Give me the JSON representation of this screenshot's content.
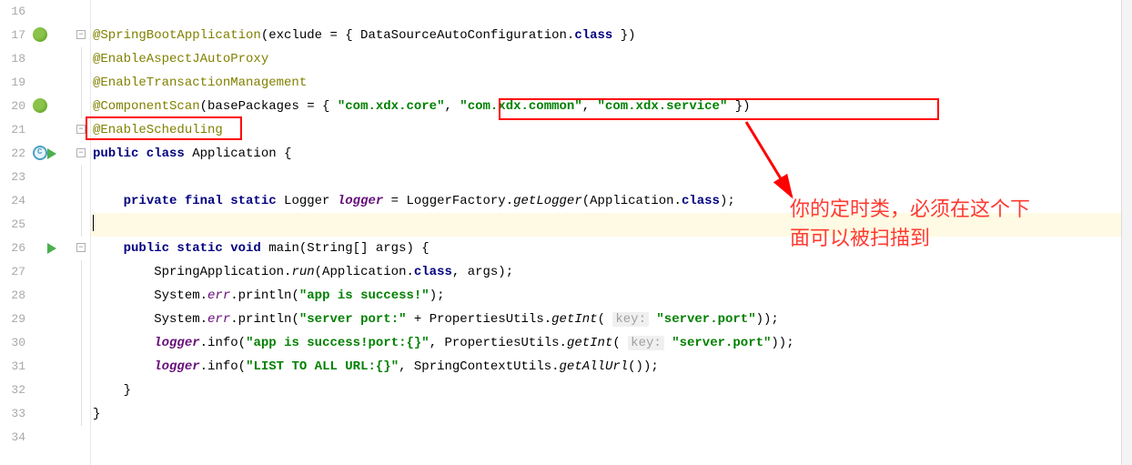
{
  "gutter": {
    "start": 16,
    "end": 34
  },
  "code": {
    "l16": "",
    "l17_ann": "@SpringBootApplication",
    "l17_rest": "(exclude = { DataSourceAutoConfiguration.",
    "l17_kw": "class",
    "l17_end": " })",
    "l18": "@EnableAspectJAutoProxy",
    "l19": "@EnableTransactionManagement",
    "l20_ann": "@ComponentScan",
    "l20_mid": "(basePackages = { ",
    "l20_s1": "\"com.xdx.core\"",
    "l20_c1": ", ",
    "l20_s2": "\"com.xdx.common\"",
    "l20_c2": ", ",
    "l20_s3": "\"com.xdx.service\"",
    "l20_end": " })",
    "l21": "@EnableScheduling",
    "l22_a": "public class ",
    "l22_b": "Application {",
    "l23": "",
    "l24_a": "    ",
    "l24_kw": "private final static ",
    "l24_type": "Logger ",
    "l24_var": "logger",
    "l24_eq": " = LoggerFactory.",
    "l24_call": "getLogger",
    "l24_arg": "(Application.",
    "l24_kw2": "class",
    "l24_end": ");",
    "l25": "    ",
    "l26_a": "    ",
    "l26_kw": "public static void ",
    "l26_rest": "main(String[] args) {",
    "l27_a": "        SpringApplication.",
    "l27_call": "run",
    "l27_b": "(Application.",
    "l27_kw": "class",
    "l27_c": ", args);",
    "l28_a": "        System.",
    "l28_err": "err",
    "l28_b": ".println(",
    "l28_s": "\"app is success!\"",
    "l28_c": ");",
    "l29_a": "        System.",
    "l29_err": "err",
    "l29_b": ".println(",
    "l29_s": "\"server port:\"",
    "l29_c": " + PropertiesUtils.",
    "l29_call": "getInt",
    "l29_d": "( ",
    "l29_hint": "key:",
    "l29_e": " ",
    "l29_s2": "\"server.port\"",
    "l29_f": "));",
    "l30_a": "        ",
    "l30_log": "logger",
    "l30_b": ".info(",
    "l30_s": "\"app is success!port:{}\"",
    "l30_c": ", PropertiesUtils.",
    "l30_call": "getInt",
    "l30_d": "( ",
    "l30_hint": "key:",
    "l30_e": " ",
    "l30_s2": "\"server.port\"",
    "l30_f": "));",
    "l31_a": "        ",
    "l31_log": "logger",
    "l31_b": ".info(",
    "l31_s": "\"LIST TO ALL URL:{}\"",
    "l31_c": ", SpringContextUtils.",
    "l31_call": "getAllUrl",
    "l31_d": "());",
    "l32": "    }",
    "l33": "}",
    "l34": ""
  },
  "annotation": {
    "line1": "你的定时类，必须在这个下",
    "line2": "面可以被扫描到"
  }
}
